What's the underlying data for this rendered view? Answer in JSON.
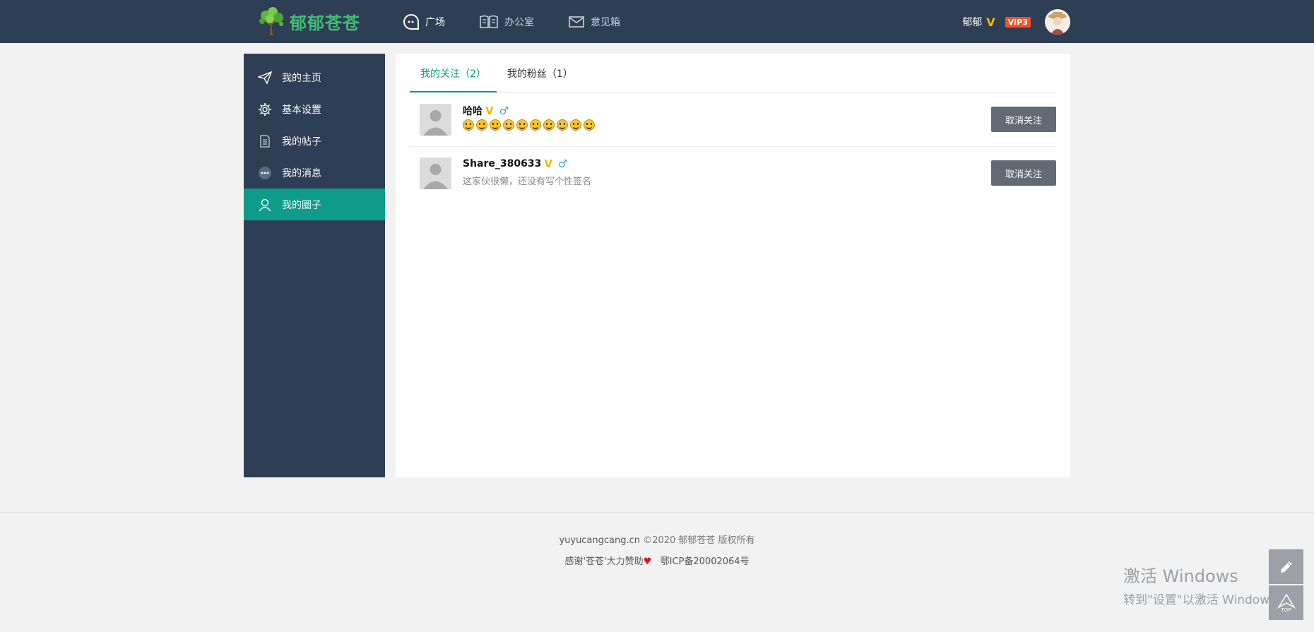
{
  "header": {
    "logo_text": "郁郁苍苍",
    "nav": [
      {
        "label": "广场",
        "icon": "chat-bubble-icon"
      },
      {
        "label": "办公室",
        "icon": "open-book-icon"
      },
      {
        "label": "意见箱",
        "icon": "mail-icon"
      }
    ],
    "user": {
      "name": "郁郁",
      "v_badge": "V",
      "vip": "VIP3"
    }
  },
  "sidebar": {
    "items": [
      {
        "label": "我的主页",
        "icon": "paper-plane-icon",
        "active": false
      },
      {
        "label": "基本设置",
        "icon": "gear-icon",
        "active": false
      },
      {
        "label": "我的帖子",
        "icon": "document-icon",
        "active": false
      },
      {
        "label": "我的消息",
        "icon": "message-dots-icon",
        "active": false
      },
      {
        "label": "我的圈子",
        "icon": "user-icon",
        "active": true
      }
    ]
  },
  "tabs": [
    {
      "label": "我的关注（2）",
      "active": true
    },
    {
      "label": "我的粉丝（1）",
      "active": false
    }
  ],
  "follows": [
    {
      "name": "哈哈",
      "v_badge": "V",
      "gender": "♂",
      "signature": "",
      "emoji_count": 10,
      "button": "取消关注"
    },
    {
      "name": "Share_380633",
      "v_badge": "V",
      "gender": "♂",
      "signature": "这家伙很懒，还没有写个性签名",
      "button": "取消关注"
    }
  ],
  "footer": {
    "domain": "yuyucangcang.cn",
    "copyright": "©2020",
    "owner": "郁郁苍苍 版权所有",
    "thanks": "感谢'苍苍'大力赞助",
    "heart": "♥",
    "icp": "鄂ICP备20002064号"
  },
  "watermark": {
    "line1": "激活 Windows",
    "line2": "转到\"设置\"以激活 Windows。"
  },
  "float_buttons": {
    "top_label": "TOP"
  },
  "colors": {
    "header_bg": "#2e3e55",
    "accent": "#0e9b88",
    "logo_green": "#3fbf74",
    "vip_red": "#f0522b",
    "v_gold": "#f5b800",
    "button_gray": "#636975"
  }
}
